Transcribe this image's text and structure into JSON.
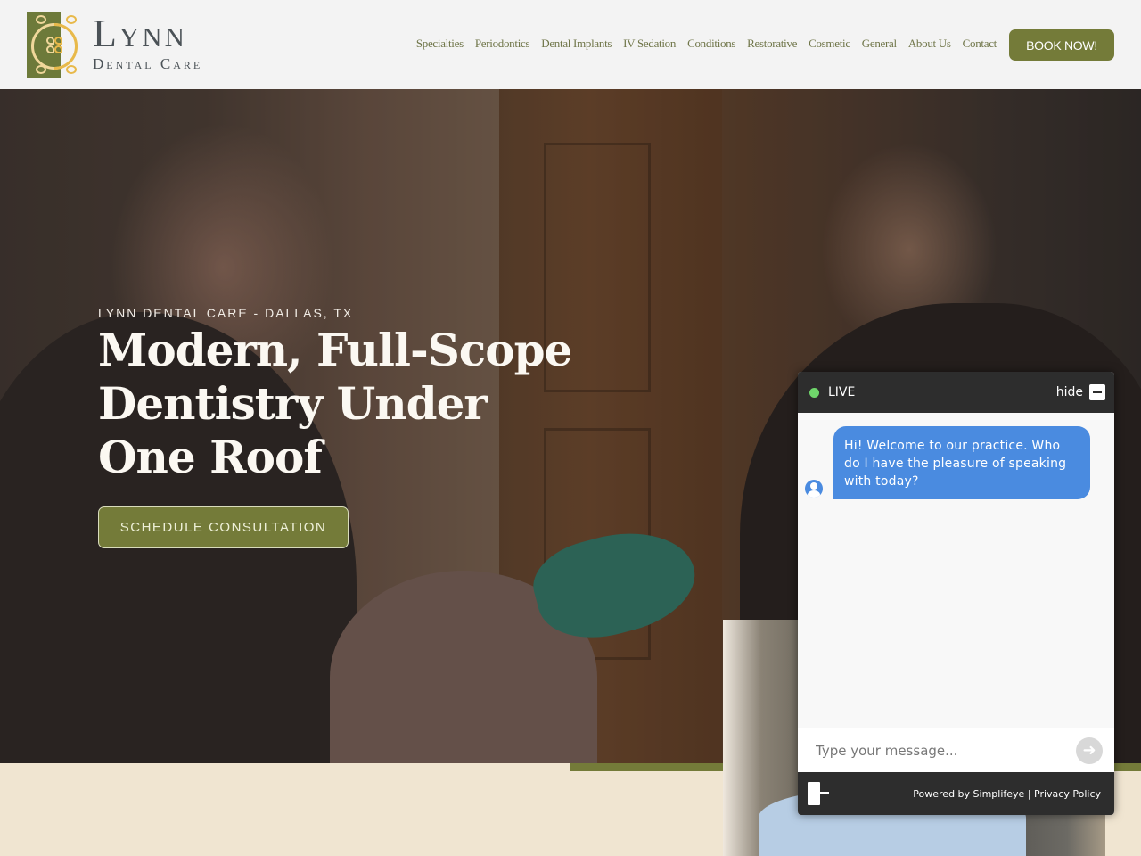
{
  "header": {
    "logo": {
      "name": "Lynn",
      "subtitle": "Dental Care"
    },
    "nav": [
      {
        "label": "Specialties"
      },
      {
        "label": "Periodontics"
      },
      {
        "label": "Dental Implants"
      },
      {
        "label": "IV Sedation"
      },
      {
        "label": "Conditions"
      },
      {
        "label": "Restorative"
      },
      {
        "label": "Cosmetic"
      },
      {
        "label": "General"
      },
      {
        "label": "About Us"
      },
      {
        "label": "Contact"
      }
    ],
    "book_label": "BOOK NOW!"
  },
  "hero": {
    "eyebrow": "LYNN DENTAL CARE - DALLAS, TX",
    "headline": "Modern, Full-Scope Dentistry Under One Roof",
    "cta_label": "SCHEDULE CONSULTATION"
  },
  "chat": {
    "status": "LIVE",
    "hide_label": "hide",
    "message": "Hi! Welcome to our practice.  Who do I have the pleasure of speaking with today?",
    "input_placeholder": "Type your message...",
    "powered_by": "Powered by Simplifeye",
    "separator": "|",
    "privacy_label": "Privacy Policy"
  },
  "colors": {
    "brand_green": "#747b39",
    "chat_blue": "#4a8be0",
    "live_green": "#6fd66b",
    "cream": "#f0e5d1"
  }
}
